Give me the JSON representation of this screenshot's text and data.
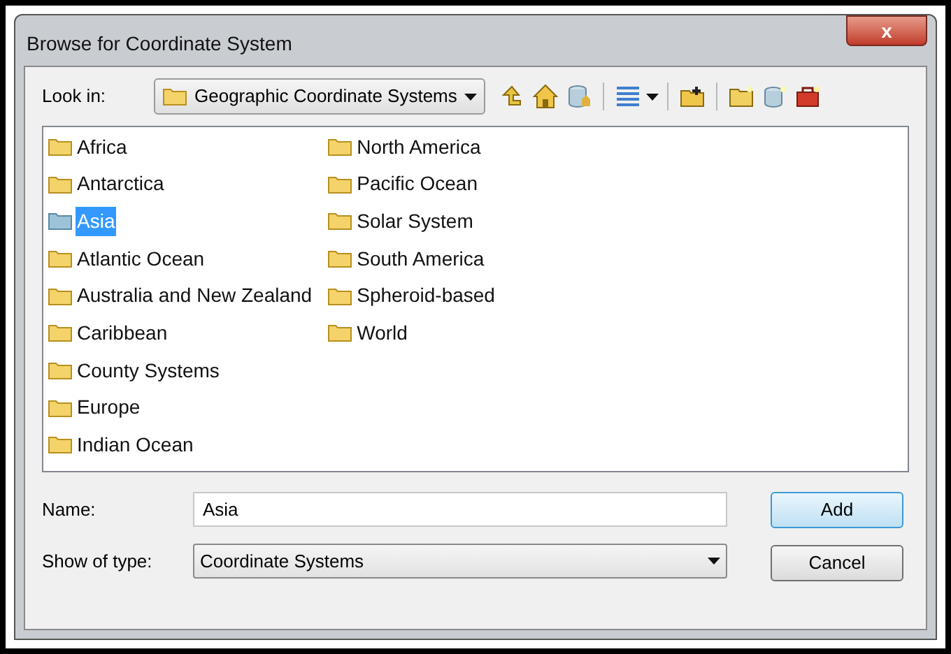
{
  "window": {
    "title": "Browse for Coordinate System",
    "close": "x"
  },
  "look_in": {
    "label": "Look in:",
    "value": "Geographic Coordinate Systems"
  },
  "items": [
    {
      "label": "Africa",
      "selected": false
    },
    {
      "label": "Antarctica",
      "selected": false
    },
    {
      "label": "Asia",
      "selected": true
    },
    {
      "label": "Atlantic Ocean",
      "selected": false
    },
    {
      "label": "Australia and New Zealand",
      "selected": false
    },
    {
      "label": "Caribbean",
      "selected": false
    },
    {
      "label": "County Systems",
      "selected": false
    },
    {
      "label": "Europe",
      "selected": false
    },
    {
      "label": "Indian Ocean",
      "selected": false
    },
    {
      "label": "North America",
      "selected": false
    },
    {
      "label": "Pacific Ocean",
      "selected": false
    },
    {
      "label": "Solar System",
      "selected": false
    },
    {
      "label": "South America",
      "selected": false
    },
    {
      "label": "Spheroid-based",
      "selected": false
    },
    {
      "label": "World",
      "selected": false
    }
  ],
  "name": {
    "label": "Name:",
    "value": "Asia"
  },
  "type": {
    "label": "Show of type:",
    "value": "Coordinate Systems"
  },
  "buttons": [
    {
      "label": "Add",
      "kind": "default"
    },
    {
      "label": "Cancel",
      "kind": "normal"
    }
  ]
}
